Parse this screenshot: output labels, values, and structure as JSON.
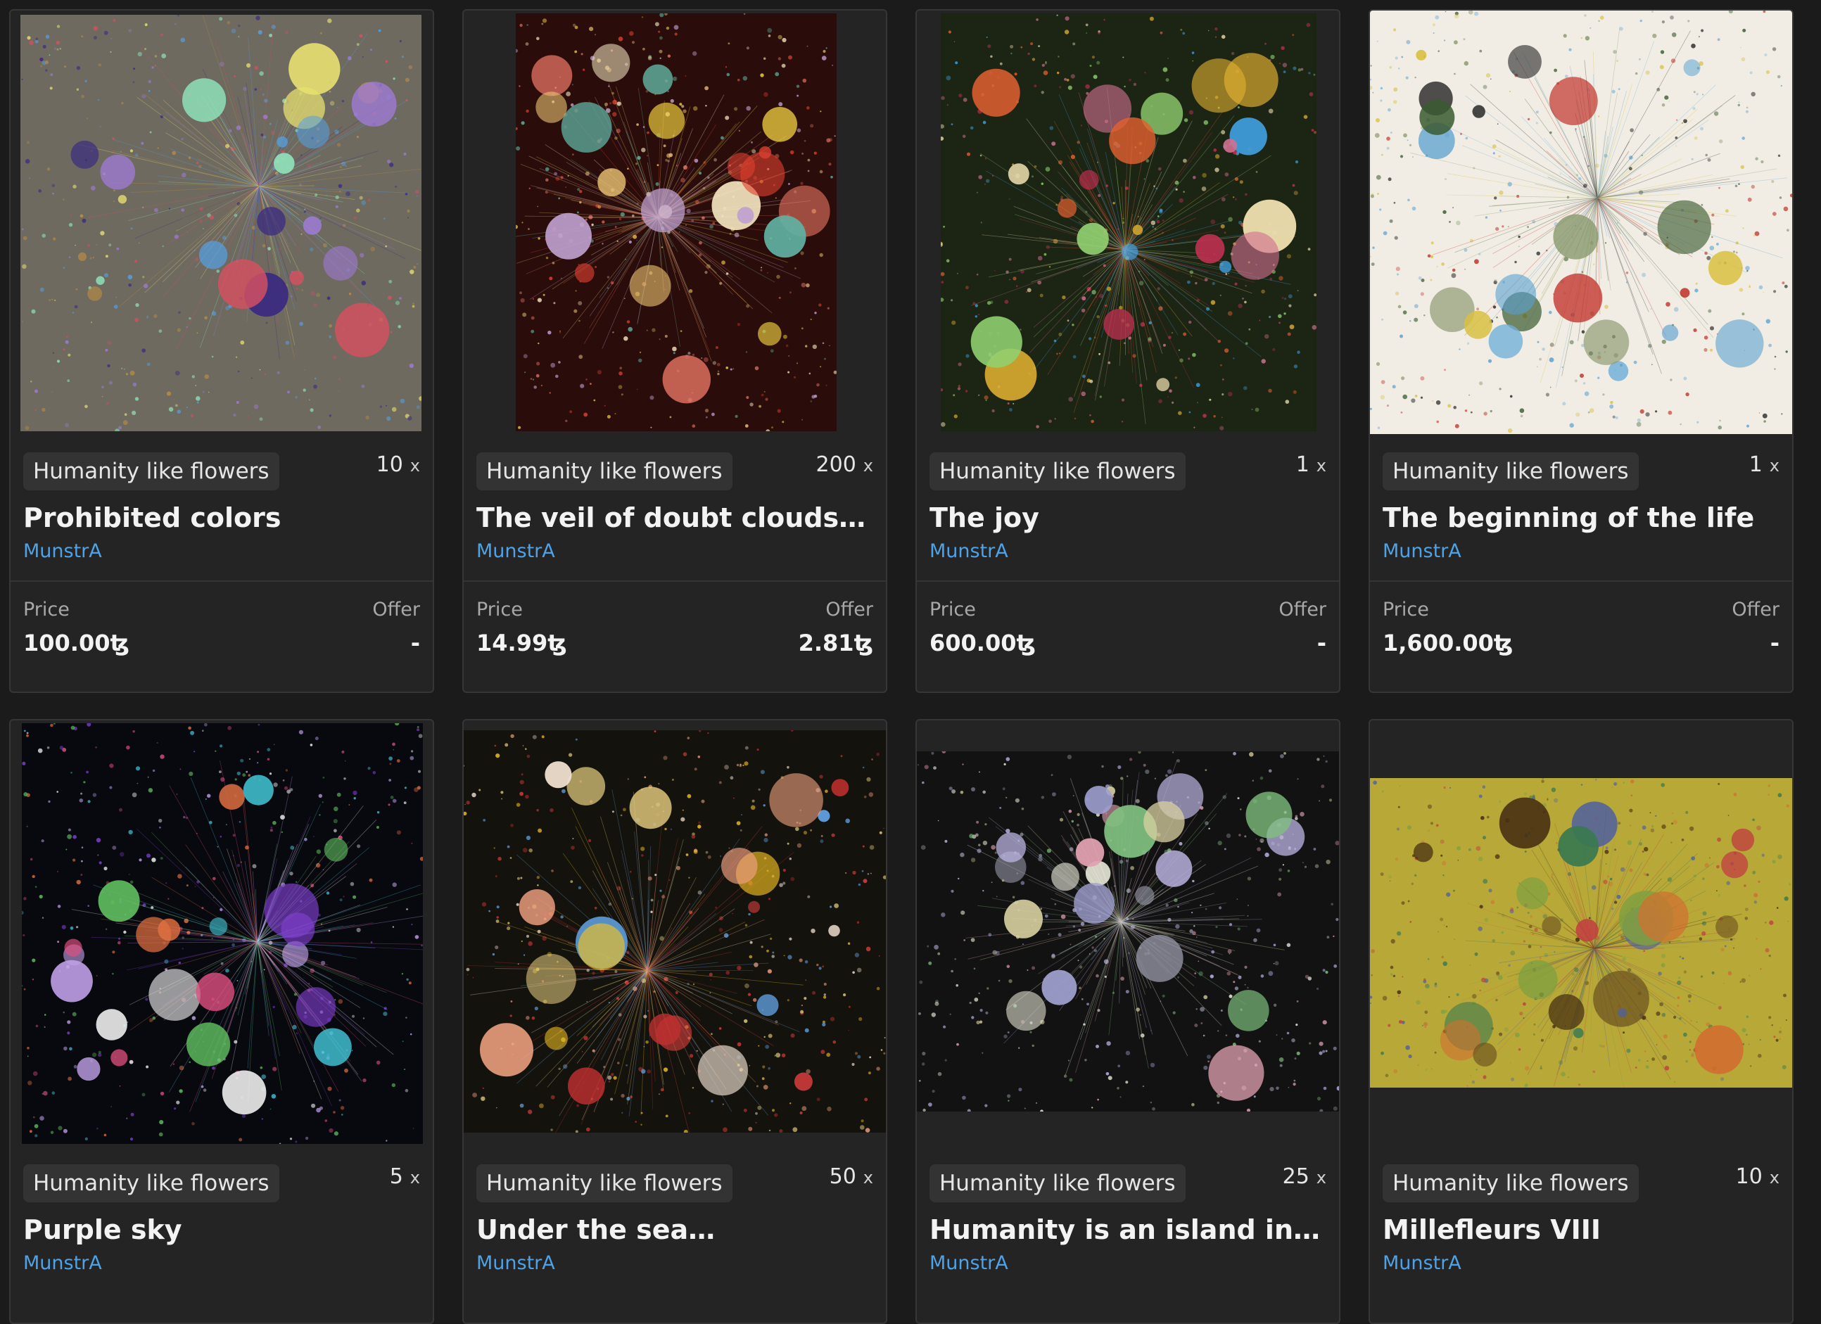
{
  "labels": {
    "price": "Price",
    "offer": "Offer",
    "edition_suffix": "x"
  },
  "cards": [
    {
      "series": "Humanity like flowers",
      "editions": "10",
      "title": "Prohibited colors",
      "artist": "MunstrA",
      "price": "100.00ꜩ",
      "offer": "-",
      "art_bg": "#6e6a60",
      "palette": [
        "#a07bd6",
        "#e8e070",
        "#8fe0b8",
        "#3a2a80",
        "#d45060",
        "#55a0e0",
        "#c09040"
      ]
    },
    {
      "series": "Humanity like flowers",
      "editions": "200",
      "title": "The veil of doubt clouds yo…",
      "artist": "MunstrA",
      "price": "14.99ꜩ",
      "offer": "2.81ꜩ",
      "art_bg": "#2a0d0a",
      "palette": [
        "#e04030",
        "#f0d040",
        "#f5e6c0",
        "#c0a0d0",
        "#e07060",
        "#60b0a0",
        "#e8c070"
      ]
    },
    {
      "series": "Humanity like flowers",
      "editions": "1",
      "title": "The joy",
      "artist": "MunstrA",
      "price": "600.00ꜩ",
      "offer": "-",
      "art_bg": "#1c2414",
      "palette": [
        "#e0b030",
        "#f0e0b0",
        "#c03050",
        "#40a0e0",
        "#e06030",
        "#90d070",
        "#d07090"
      ]
    },
    {
      "series": "Humanity like flowers",
      "editions": "1",
      "title": "The beginning of the life",
      "artist": "MunstrA",
      "price": "1,600.00ꜩ",
      "offer": "-",
      "art_bg": "#f1ede4",
      "palette": [
        "#5aa0d0",
        "#3a5a30",
        "#c03028",
        "#d8c040",
        "#8a9a70",
        "#2a2a2a",
        "#70b0d8"
      ]
    },
    {
      "series": "Humanity like flowers",
      "editions": "5",
      "title": "Purple sky",
      "artist": "MunstrA",
      "price": "",
      "offer": "",
      "art_bg": "#08080f",
      "palette": [
        "#c0a0e8",
        "#e05080",
        "#40c0d0",
        "#f0f0f0",
        "#60c060",
        "#e07040",
        "#8040d0"
      ]
    },
    {
      "series": "Humanity like flowers",
      "editions": "50",
      "title": "Under the sea…",
      "artist": "MunstrA",
      "price": "",
      "offer": "",
      "art_bg": "#14120c",
      "palette": [
        "#f0a080",
        "#f0c020",
        "#e04040",
        "#60a0e0",
        "#e8d080",
        "#c03030",
        "#f0e0d0"
      ]
    },
    {
      "series": "Humanity like flowers",
      "editions": "25",
      "title": "Humanity is an island in the…",
      "artist": "MunstrA",
      "price": "",
      "offer": "",
      "art_bg": "#121212",
      "palette": [
        "#c0b8e8",
        "#e0a0b0",
        "#80c080",
        "#f0f0e0",
        "#a0a0d0",
        "#d8d0a0",
        "#9090a0"
      ]
    },
    {
      "series": "Humanity like flowers",
      "editions": "10",
      "title": "Millefleurs VIII",
      "artist": "MunstrA",
      "price": "",
      "offer": "",
      "art_bg": "#b8a838",
      "palette": [
        "#6a5020",
        "#3a7a50",
        "#c04040",
        "#5060a0",
        "#80a040",
        "#d07030",
        "#402810"
      ]
    }
  ]
}
